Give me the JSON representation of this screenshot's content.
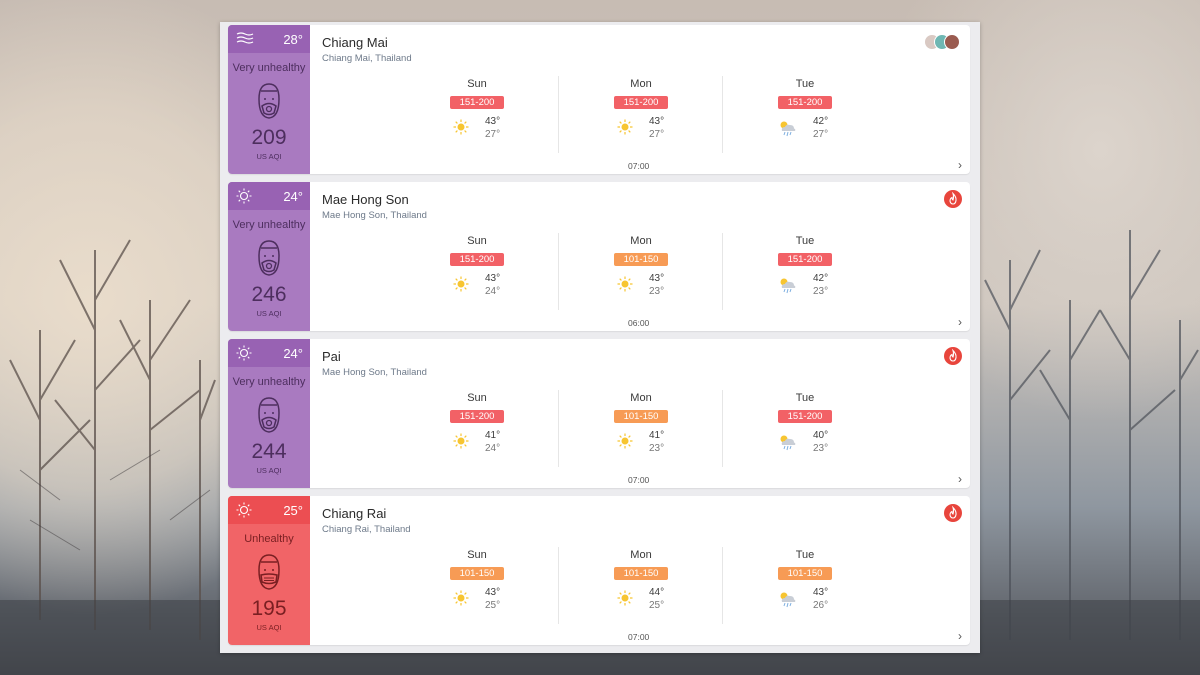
{
  "cards": [
    {
      "city": "Chiang Mai",
      "region": "Chiang Mai, Thailand",
      "temp": "28°",
      "level": "Very unhealthy",
      "aqi": "209",
      "aqi_unit": "US AQI",
      "time": "07:00",
      "weather_icon": "wind-icon",
      "badge": "avatars",
      "days": [
        {
          "name": "Sun",
          "range": "151-200",
          "hi": "43°",
          "lo": "27°",
          "icon": "sun-icon"
        },
        {
          "name": "Mon",
          "range": "151-200",
          "hi": "43°",
          "lo": "27°",
          "icon": "sun-icon"
        },
        {
          "name": "Tue",
          "range": "151-200",
          "hi": "42°",
          "lo": "27°",
          "icon": "storm-icon"
        }
      ]
    },
    {
      "city": "Mae Hong Son",
      "region": "Mae Hong Son, Thailand",
      "temp": "24°",
      "level": "Very unhealthy",
      "aqi": "246",
      "aqi_unit": "US AQI",
      "time": "06:00",
      "weather_icon": "sun-outline-icon",
      "badge": "fire",
      "days": [
        {
          "name": "Sun",
          "range": "151-200",
          "hi": "43°",
          "lo": "24°",
          "icon": "sun-icon"
        },
        {
          "name": "Mon",
          "range": "101-150",
          "hi": "43°",
          "lo": "23°",
          "icon": "sun-icon"
        },
        {
          "name": "Tue",
          "range": "151-200",
          "hi": "42°",
          "lo": "23°",
          "icon": "storm-icon"
        }
      ]
    },
    {
      "city": "Pai",
      "region": "Mae Hong Son, Thailand",
      "temp": "24°",
      "level": "Very unhealthy",
      "aqi": "244",
      "aqi_unit": "US AQI",
      "time": "07:00",
      "weather_icon": "sun-outline-icon",
      "badge": "fire",
      "days": [
        {
          "name": "Sun",
          "range": "151-200",
          "hi": "41°",
          "lo": "24°",
          "icon": "sun-icon"
        },
        {
          "name": "Mon",
          "range": "101-150",
          "hi": "41°",
          "lo": "23°",
          "icon": "sun-icon"
        },
        {
          "name": "Tue",
          "range": "151-200",
          "hi": "40°",
          "lo": "23°",
          "icon": "storm-icon"
        }
      ]
    },
    {
      "city": "Chiang Rai",
      "region": "Chiang Rai, Thailand",
      "temp": "25°",
      "level": "Unhealthy",
      "aqi": "195",
      "aqi_unit": "US AQI",
      "time": "07:00",
      "weather_icon": "sun-outline-icon",
      "badge": "fire",
      "days": [
        {
          "name": "Sun",
          "range": "101-150",
          "hi": "43°",
          "lo": "25°",
          "icon": "sun-icon"
        },
        {
          "name": "Mon",
          "range": "101-150",
          "hi": "44°",
          "lo": "25°",
          "icon": "sun-icon"
        },
        {
          "name": "Tue",
          "range": "101-150",
          "hi": "43°",
          "lo": "26°",
          "icon": "storm-icon"
        }
      ]
    }
  ],
  "colors": {
    "very_unhealthy": "#a97ac0",
    "unhealthy": "#f16467",
    "range_151_200": "#f26166",
    "range_101_150": "#f79b55",
    "fire_badge": "#e8453c"
  }
}
